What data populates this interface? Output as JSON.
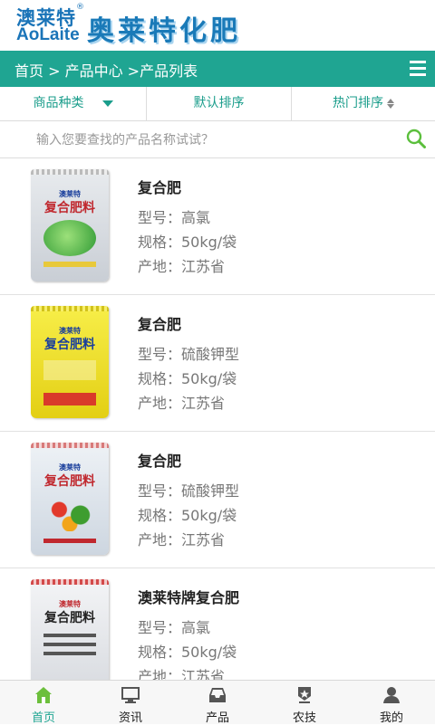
{
  "header": {
    "logo_cn": "澳莱特",
    "logo_reg": "®",
    "logo_en": "AoLaite",
    "brand_title": "奥莱特化肥"
  },
  "nav": {
    "breadcrumb": "首页 > 产品中心 >产品列表",
    "menu_icon": "hamburger-menu-icon"
  },
  "filters": {
    "category": "商品种类",
    "default_sort": "默认排序",
    "hot_sort": "热门排序"
  },
  "search": {
    "placeholder": "输入您要查找的产品名称试试？",
    "icon": "search-icon"
  },
  "products": [
    {
      "name": "复合肥",
      "model": "型号：高氯",
      "spec": "规格：50kg/袋",
      "origin": "产地：江苏省",
      "bag_brand": "澳莱特",
      "bag_text": "复合肥料",
      "bag_color": "#d9dde3",
      "bag_text_color": "#c0282e"
    },
    {
      "name": "复合肥",
      "model": "型号：硫酸钾型",
      "spec": "规格：50kg/袋",
      "origin": "产地：江苏省",
      "bag_brand": "澳莱特",
      "bag_text": "复合肥料",
      "bag_color": "#f3e52c",
      "bag_text_color": "#1a3f9c"
    },
    {
      "name": "复合肥",
      "model": "型号：硫酸钾型",
      "spec": "规格：50kg/袋",
      "origin": "产地：江苏省",
      "bag_brand": "澳莱特",
      "bag_text": "复合肥料",
      "bag_color": "#dfe6ee",
      "bag_text_color": "#c0282e"
    },
    {
      "name": "澳莱特牌复合肥",
      "model": "型号：高氯",
      "spec": "规格：50kg/袋",
      "origin": "产地：江苏省",
      "bag_brand": "澳莱特",
      "bag_text": "复合肥料",
      "bag_color": "#eef0f2",
      "bag_text_color": "#222222"
    }
  ],
  "tabbar": [
    {
      "label": "首页",
      "icon": "home-icon",
      "active": true
    },
    {
      "label": "资讯",
      "icon": "monitor-icon",
      "active": false
    },
    {
      "label": "产品",
      "icon": "inbox-icon",
      "active": false
    },
    {
      "label": "农技",
      "icon": "medal-icon",
      "active": false
    },
    {
      "label": "我的",
      "icon": "user-icon",
      "active": false
    }
  ],
  "colors": {
    "primary": "#1fa592",
    "brand_blue": "#1a74b8"
  }
}
